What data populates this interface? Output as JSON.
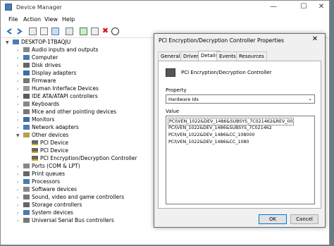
{
  "window": {
    "title": "Device Manager",
    "controls": {
      "minimize": "—",
      "maximize": "☐",
      "close": "✕"
    }
  },
  "menu": [
    "File",
    "Action",
    "View",
    "Help"
  ],
  "tree": {
    "root": "DESKTOP-1TBAQJU",
    "categories": [
      "Audio inputs and outputs",
      "Computer",
      "Disk drives",
      "Display adapters",
      "Firmware",
      "Human Interface Devices",
      "IDE ATA/ATAPI controllers",
      "Keyboards",
      "Mice and other pointing devices",
      "Monitors",
      "Network adapters",
      "Other devices",
      "PCI Device",
      "PCI Device",
      "PCI Encryption/Decryption Controller",
      "Ports (COM & LPT)",
      "Print queues",
      "Processors",
      "Software devices",
      "Sound, video and game controllers",
      "Storage controllers",
      "System devices",
      "Universal Serial Bus controllers"
    ]
  },
  "dialog": {
    "title": "PCI Encryption/Decryption Controller Properties",
    "close": "✕",
    "tabs": [
      "General",
      "Driver",
      "Details",
      "Events",
      "Resources"
    ],
    "device_name": "PCI Encryption/Decryption Controller",
    "property_label": "Property",
    "property_value": "Hardware Ids",
    "value_label": "Value",
    "values": [
      "PCI\\VEN_1022&DEV_1486&SUBSYS_7C021462&REV_00",
      "PCI\\VEN_1022&DEV_1486&SUBSYS_7C021462",
      "PCI\\VEN_1022&DEV_1486&CC_108000",
      "PCI\\VEN_1022&DEV_1486&CC_1080"
    ],
    "ok_label": "OK",
    "cancel_label": "Cancel"
  }
}
